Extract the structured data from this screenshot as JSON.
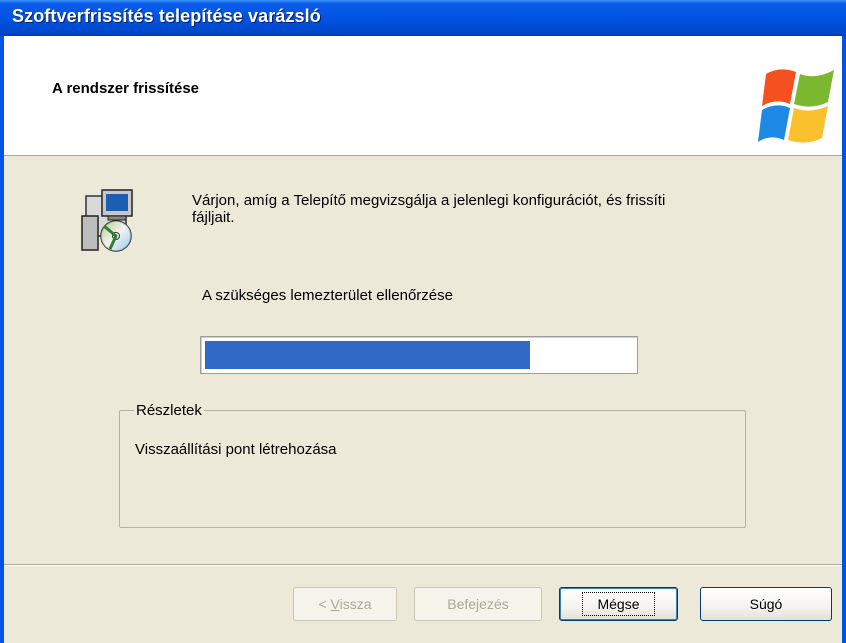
{
  "window": {
    "title": "Szoftverfrissítés telepítése varázsló"
  },
  "header": {
    "title": "A rendszer frissítése"
  },
  "content": {
    "instruction_line1": "Várjon, amíg a Telepítő megvizsgálja a jelenlegi konfigurációt, és frissíti",
    "instruction_line2": "fájljait.",
    "status": "A szükséges lemezterület ellenőrzése",
    "progress_fraction": 0.76
  },
  "details": {
    "legend": "Részletek",
    "text": "Visszaállítási pont létrehozása"
  },
  "buttons": {
    "back_prefix": "< ",
    "back_accel": "V",
    "back_rest": "issza",
    "finish": "Befejezés",
    "cancel": "Mégse",
    "help": "Súgó"
  },
  "colors": {
    "titlebar": "#0054e3",
    "progress_fill": "#3169c6",
    "dialog_bg": "#ece9d8"
  },
  "icons": {
    "setup": "setup-computer-cd-icon",
    "brand": "windows-logo-icon"
  }
}
